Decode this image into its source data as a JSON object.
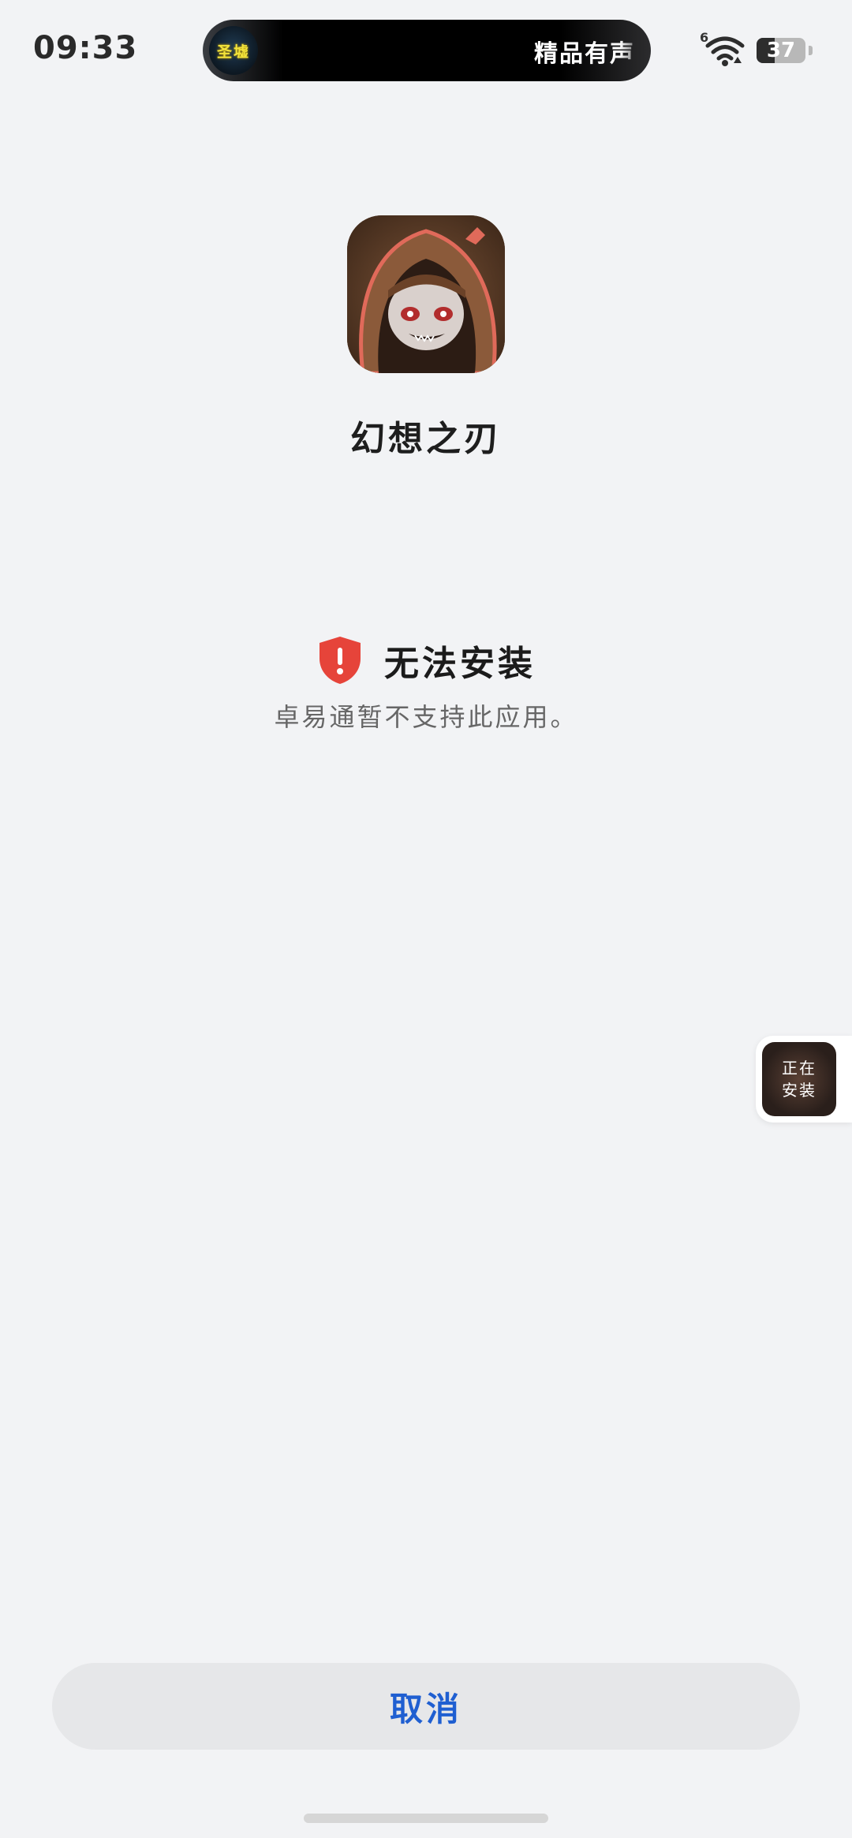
{
  "status_bar": {
    "time": "09:33",
    "island_badge": "圣墟",
    "island_text": "精品有声",
    "network_label": "6",
    "battery": "37",
    "battery_level": 0.37
  },
  "app": {
    "name": "幻想之刃",
    "icon": "hooded-character-icon"
  },
  "error": {
    "icon": "shield-alert-icon",
    "title": "无法安装",
    "description": "卓易通暂不支持此应用。"
  },
  "floating_widget": {
    "line1": "正在",
    "line2": "安装"
  },
  "actions": {
    "cancel_label": "取消"
  },
  "colors": {
    "accent": "#1f5fd1",
    "error": "#e6443a",
    "background": "#f2f3f5"
  }
}
